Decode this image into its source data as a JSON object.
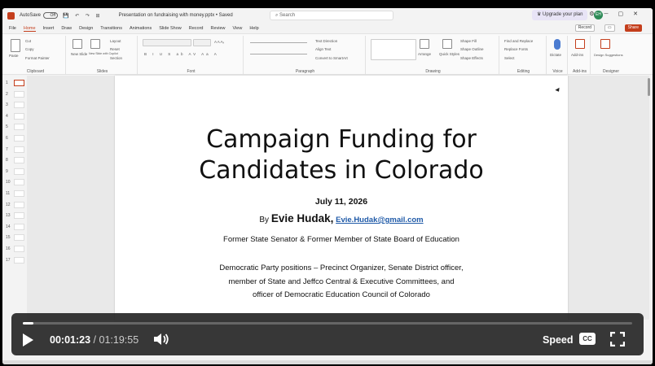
{
  "titlebar": {
    "autosave_label": "AutoSave",
    "autosave_state": "Off",
    "document_title": "Presentation on fundraising with money.pptx • Saved",
    "search_placeholder": "Search",
    "upgrade_label": "Upgrade your plan",
    "avatar_initials": "EH"
  },
  "tabs": [
    "File",
    "Home",
    "Insert",
    "Draw",
    "Design",
    "Transitions",
    "Animations",
    "Slide Show",
    "Record",
    "Review",
    "View",
    "Help"
  ],
  "active_tab": "Home",
  "tab_actions": {
    "record": "Record",
    "share": "Share"
  },
  "ribbon": {
    "groups": [
      "Clipboard",
      "Slides",
      "Font",
      "Paragraph",
      "Drawing",
      "Editing",
      "Voice",
      "Add-ins",
      "Designer"
    ],
    "clipboard": {
      "paste": "Paste",
      "cut": "Cut",
      "copy": "Copy",
      "format_painter": "Format Painter"
    },
    "slides": {
      "new_slide": "New Slide",
      "reuse": "New Slide with Copilot",
      "layout": "Layout",
      "reset": "Reset",
      "section": "Section"
    },
    "paragraph": {
      "text_direction": "Text Direction",
      "align_text": "Align Text",
      "smartart": "Convert to SmartArt"
    },
    "drawing": {
      "arrange": "Arrange",
      "quick_styles": "Quick Styles",
      "shape_fill": "Shape Fill",
      "shape_outline": "Shape Outline",
      "shape_effects": "Shape Effects"
    },
    "editing": {
      "find": "Find and Replace",
      "replace": "Replace Fonts",
      "select": "Select"
    },
    "voice": {
      "dictate": "Dictate"
    },
    "addins": {
      "label": "Add-ins"
    },
    "designer": {
      "label": "Design Suggestions"
    }
  },
  "thumbnails": [
    "1",
    "2",
    "3",
    "4",
    "5",
    "6",
    "7",
    "8",
    "9",
    "10",
    "11",
    "12",
    "13",
    "14",
    "15",
    "16",
    "17"
  ],
  "slide": {
    "title_line1": "Campaign Funding for",
    "title_line2": "Candidates in Colorado",
    "date": "July 11, 2026",
    "by": "By",
    "author": "Evie Hudak,",
    "email": "Evie.Hudak@gmail.com",
    "role": "Former State Senator & Former Member of State Board of Education",
    "desc_line1": "Democratic Party positions – Precinct Organizer, Senate District officer,",
    "desc_line2": "member of State and Jeffco Central & Executive Committees, and",
    "desc_line3": "officer of Democratic Education Council of Colorado"
  },
  "player": {
    "current_time": "00:01:23",
    "separator": "/",
    "duration": "01:19:55",
    "progress_fraction": 0.017,
    "speed_label": "Speed",
    "cc_label": "CC"
  },
  "colors": {
    "accent": "#c43e1c",
    "link": "#1f5aa8",
    "player_bg": "#282828"
  }
}
